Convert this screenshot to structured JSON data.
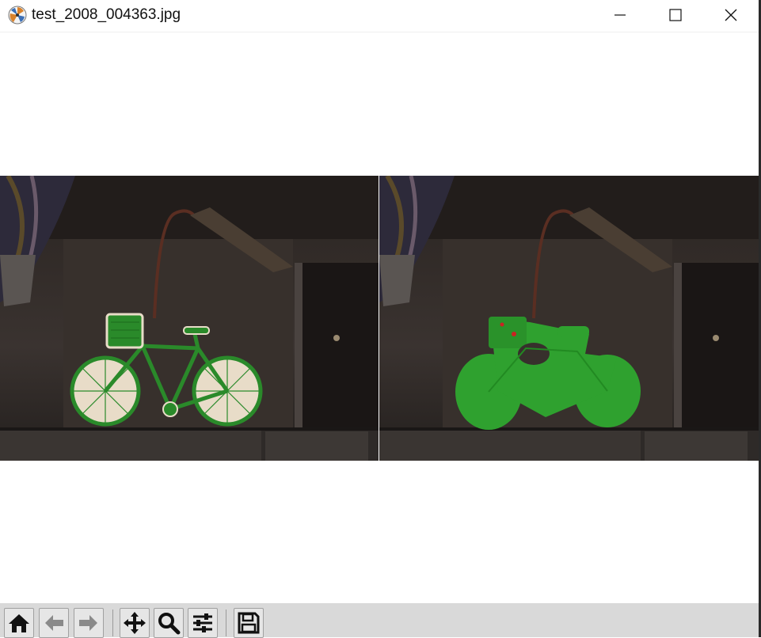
{
  "window": {
    "title": "test_2008_004363.jpg",
    "controls": [
      "minimize",
      "maximize",
      "close"
    ]
  },
  "figure": {
    "panels": [
      {
        "id": "left",
        "overlay": "bicycle segmentation outline (green with light fill)"
      },
      {
        "id": "right",
        "overlay": "bicycle segmentation mask (solid green)"
      }
    ],
    "colors": {
      "background_scene": "#2b2522",
      "mask_green": "#2fa12f",
      "outline_fill": "#eadfcf"
    }
  },
  "toolbar": {
    "buttons": [
      {
        "name": "home-button",
        "icon": "home-icon"
      },
      {
        "name": "back-button",
        "icon": "arrow-left-icon"
      },
      {
        "name": "forward-button",
        "icon": "arrow-right-icon"
      },
      {
        "name": "pan-button",
        "icon": "move-icon"
      },
      {
        "name": "zoom-button",
        "icon": "magnifier-icon"
      },
      {
        "name": "configure-subplots-button",
        "icon": "sliders-icon"
      },
      {
        "name": "save-button",
        "icon": "floppy-disk-icon"
      }
    ]
  }
}
